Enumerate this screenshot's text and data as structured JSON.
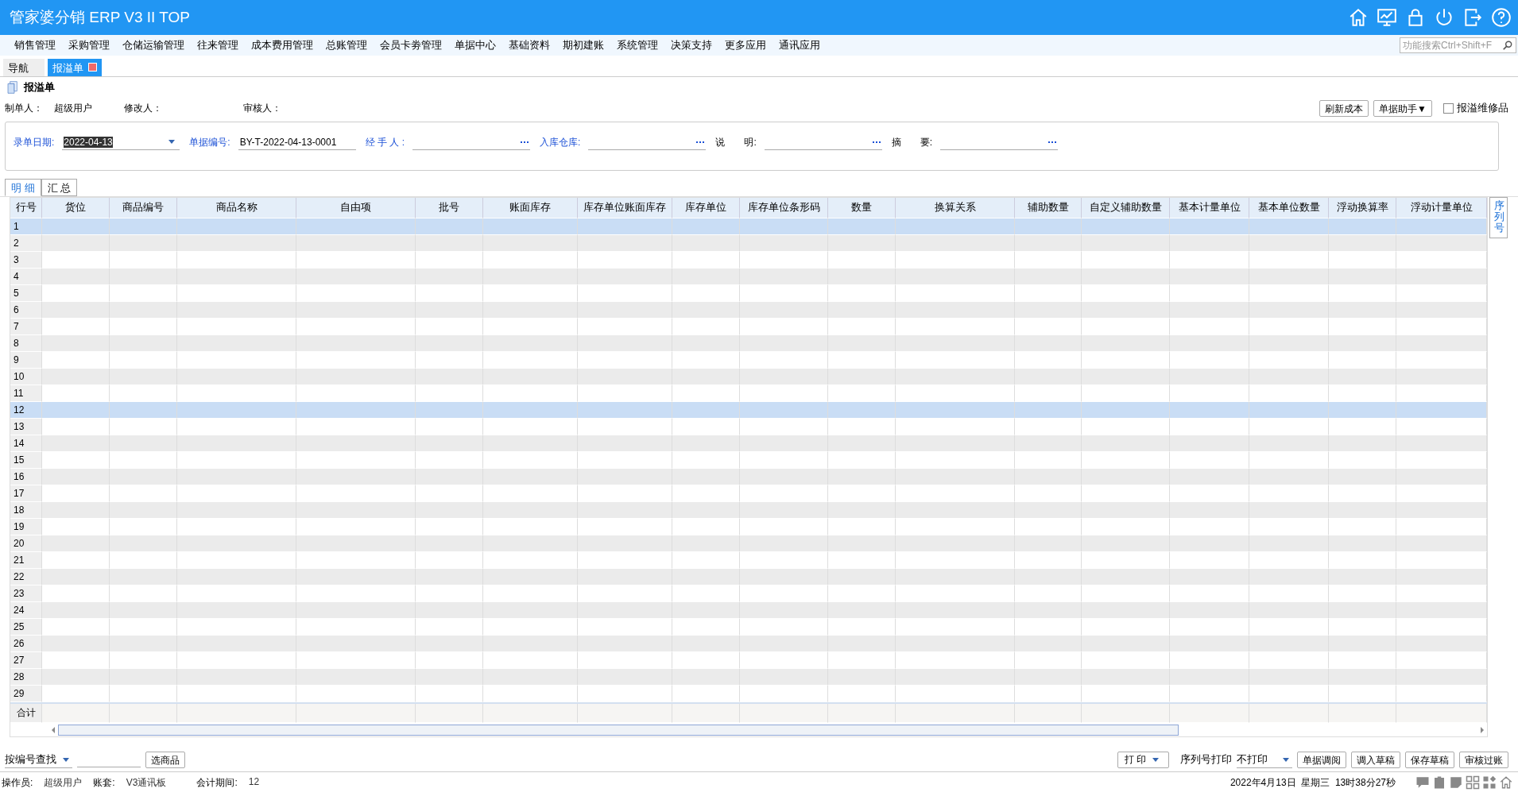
{
  "window": {
    "title": "管家婆分销 ERP V3 II TOP"
  },
  "menu": [
    "销售管理",
    "采购管理",
    "仓储运输管理",
    "往来管理",
    "成本费用管理",
    "总账管理",
    "会员卡劵管理",
    "单据中心",
    "基础资料",
    "期初建账",
    "系统管理",
    "决策支持",
    "更多应用",
    "通讯应用"
  ],
  "function_search": {
    "placeholder": "功能搜索Ctrl+Shift+F"
  },
  "page_tabs": [
    {
      "label": "导航",
      "selected": false,
      "closable": false
    },
    {
      "label": "报溢单",
      "selected": true,
      "closable": true
    }
  ],
  "document": {
    "title": "报溢单",
    "meta": [
      {
        "label": "制单人：",
        "value": "超级用户"
      },
      {
        "label": "修改人："
      },
      {
        "label": "审核人："
      }
    ],
    "actions": [
      "刷新成本",
      "单据助手▼"
    ],
    "repair_checkbox": {
      "label": "报溢维修品",
      "checked": false
    },
    "fields": [
      {
        "label": "录单日期:",
        "value": "2022-04-13",
        "kind": "date",
        "label_blue": true
      },
      {
        "label": "单据编号:",
        "value": "BY-T-2022-04-13-0001",
        "kind": "text",
        "label_blue": true
      },
      {
        "label": "经 手 人 :",
        "kind": "lookup",
        "label_blue": true
      },
      {
        "label": "入库仓库:",
        "kind": "lookup",
        "label_blue": true
      },
      {
        "label": "说　　明:",
        "kind": "lookup",
        "label_blue": false
      },
      {
        "label": "摘　　要:",
        "kind": "lookup",
        "label_blue": false
      }
    ]
  },
  "detail_tabs": [
    {
      "label": "明 细",
      "selected": true
    },
    {
      "label": "汇 总",
      "selected": false
    }
  ],
  "side_tab": "序列号",
  "table": {
    "columns": [
      "行号",
      "货位",
      "商品编号",
      "商品名称",
      "自由项",
      "批号",
      "账面库存",
      "库存单位账面库存",
      "库存单位",
      "库存单位条形码",
      "数量",
      "换算关系",
      "辅助数量",
      "自定义辅助数量",
      "基本计量单位",
      "基本单位数量",
      "浮动换算率",
      "浮动计量单位"
    ],
    "rows": [
      {
        "number": "1",
        "selected": true
      },
      {
        "number": "2",
        "selected": false
      },
      {
        "number": "3",
        "selected": false
      },
      {
        "number": "4",
        "selected": false
      },
      {
        "number": "5",
        "selected": false
      },
      {
        "number": "6",
        "selected": false
      },
      {
        "number": "7",
        "selected": false
      },
      {
        "number": "8",
        "selected": false
      },
      {
        "number": "9",
        "selected": false
      },
      {
        "number": "10",
        "selected": false
      },
      {
        "number": "11",
        "selected": false
      },
      {
        "number": "12",
        "selected": true
      },
      {
        "number": "13",
        "selected": false
      },
      {
        "number": "14",
        "selected": false
      },
      {
        "number": "15",
        "selected": false
      },
      {
        "number": "16",
        "selected": false
      },
      {
        "number": "17",
        "selected": false
      },
      {
        "number": "18",
        "selected": false
      },
      {
        "number": "19",
        "selected": false
      },
      {
        "number": "20",
        "selected": false
      },
      {
        "number": "21",
        "selected": false
      },
      {
        "number": "22",
        "selected": false
      },
      {
        "number": "23",
        "selected": false
      },
      {
        "number": "24",
        "selected": false
      },
      {
        "number": "25",
        "selected": false
      },
      {
        "number": "26",
        "selected": false
      },
      {
        "number": "27",
        "selected": false
      },
      {
        "number": "28",
        "selected": false
      },
      {
        "number": "29",
        "selected": false
      }
    ],
    "total_label": "合计"
  },
  "bottom": {
    "search_mode": "按编号查找",
    "pick_button": "选商品",
    "print_button": "打 印",
    "serial_print_label": "序列号打印",
    "serial_print_value": "不打印",
    "buttons": [
      "单据调阅",
      "调入草稿",
      "保存草稿",
      "审核过账"
    ]
  },
  "status_bar": {
    "items": [
      {
        "label": "操作员:",
        "value": "超级用户"
      },
      {
        "label": "账套:",
        "value": "V3通讯板"
      },
      {
        "label": "会计期间:",
        "value": "12"
      }
    ],
    "datetime": "2022年4月13日  星期三  13时38分27秒"
  }
}
